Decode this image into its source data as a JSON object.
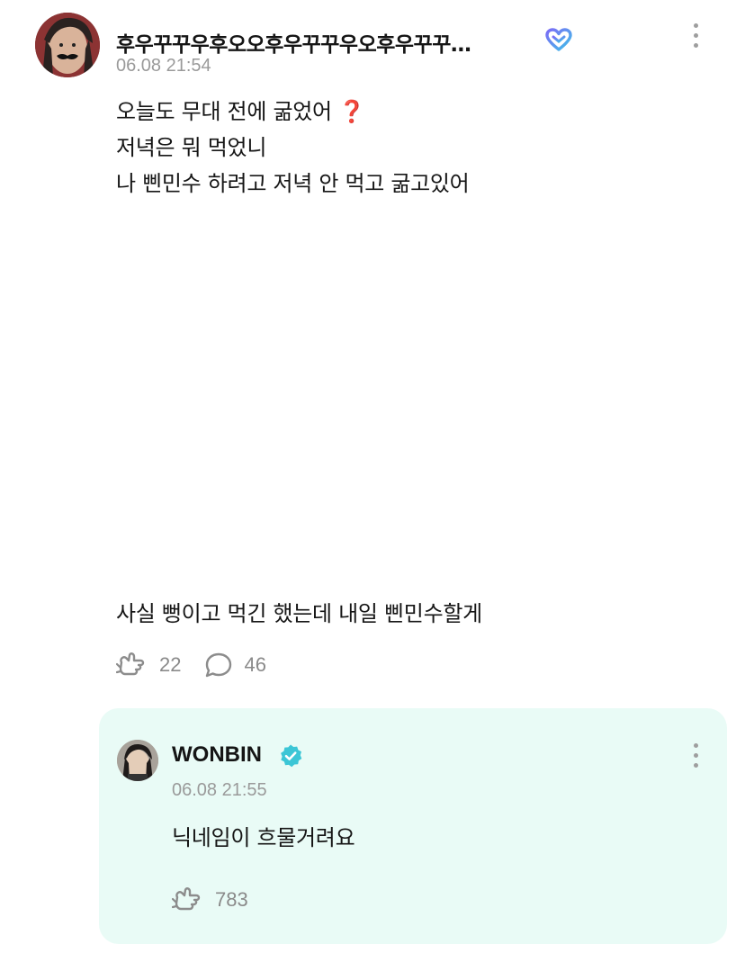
{
  "post": {
    "author_name": "후우꾸꾸우후오오후우꾸꾸우오후우꾸꾸…",
    "timestamp": "06.08 21:54",
    "body_lines": [
      "오늘도 무대 전에 굶었어",
      "저녁은 뭐 먹었니",
      "나 삔민수 하려고 저녁 안 먹고 굶고있어"
    ],
    "emoji": "❓",
    "last_line": "사실 뻥이고 먹긴 했는데 내일 삔민수할게",
    "like_count": "22",
    "comment_count": "46",
    "icons": {
      "membership": "membership-heart-icon",
      "more": "more-vertical-icon",
      "like": "like-icon",
      "comment": "comment-icon"
    }
  },
  "reply": {
    "author_name": "WONBIN",
    "timestamp": "06.08 21:55",
    "body": "닉네임이 흐물거려요",
    "like_count": "783",
    "icons": {
      "verified": "verified-badge-icon",
      "more": "more-vertical-icon",
      "like": "like-icon"
    }
  },
  "colors": {
    "reply_background": "#e9fbf6",
    "verified": "#3cc6d6",
    "membership_gradient_start": "#7b6cf6",
    "membership_gradient_end": "#3fc0e8",
    "meta_text": "#9a9a9a"
  }
}
